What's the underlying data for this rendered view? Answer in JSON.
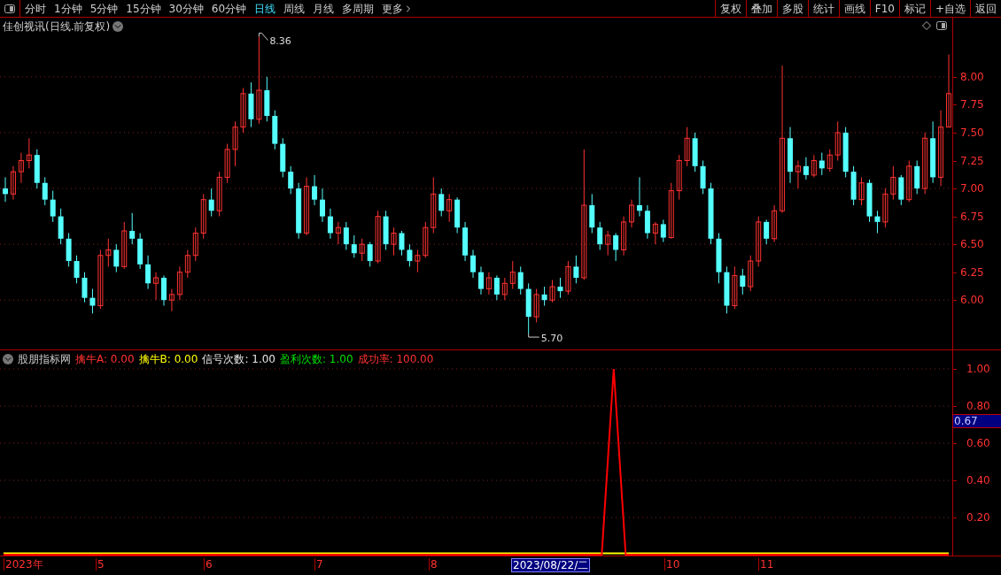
{
  "toolbar": {
    "periods": [
      {
        "label": "分时",
        "selected": false,
        "has_menu": false
      },
      {
        "label": "1分钟",
        "selected": false,
        "has_menu": false
      },
      {
        "label": "5分钟",
        "selected": false,
        "has_menu": false
      },
      {
        "label": "15分钟",
        "selected": false,
        "has_menu": false
      },
      {
        "label": "30分钟",
        "selected": false,
        "has_menu": false
      },
      {
        "label": "60分钟",
        "selected": false,
        "has_menu": false
      },
      {
        "label": "日线",
        "selected": true,
        "has_menu": false
      },
      {
        "label": "周线",
        "selected": false,
        "has_menu": false
      },
      {
        "label": "月线",
        "selected": false,
        "has_menu": false
      },
      {
        "label": "多周期",
        "selected": false,
        "has_menu": false
      },
      {
        "label": "更多",
        "selected": false,
        "has_menu": true
      }
    ],
    "actions": [
      "复权",
      "叠加",
      "多股",
      "统计",
      "画线",
      "F10",
      "标记",
      "+自选",
      "返回"
    ]
  },
  "price_pane": {
    "title": "佳创视讯(日线.前复权)",
    "high_label": "8.36",
    "low_label": "5.70",
    "chart_data": {
      "type": "candlestick",
      "grid": true,
      "ylim": [
        5.55,
        8.53
      ],
      "yticks": [
        {
          "value": 8.0,
          "label": "8.00"
        },
        {
          "value": 7.75,
          "label": "7.75"
        },
        {
          "value": 7.5,
          "label": "7.50"
        },
        {
          "value": 7.25,
          "label": "7.25"
        },
        {
          "value": 7.0,
          "label": "7.00"
        },
        {
          "value": 6.75,
          "label": "6.75"
        },
        {
          "value": 6.5,
          "label": "6.50"
        },
        {
          "value": 6.25,
          "label": "6.25"
        },
        {
          "value": 6.0,
          "label": "6.00"
        }
      ],
      "ohlc": [
        [
          7.0,
          7.1,
          6.88,
          6.95
        ],
        [
          6.95,
          7.2,
          6.9,
          7.15
        ],
        [
          7.15,
          7.32,
          7.05,
          7.25
        ],
        [
          7.25,
          7.45,
          7.18,
          7.3
        ],
        [
          7.3,
          7.35,
          7.0,
          7.05
        ],
        [
          7.05,
          7.1,
          6.85,
          6.9
        ],
        [
          6.9,
          6.98,
          6.7,
          6.75
        ],
        [
          6.75,
          6.82,
          6.5,
          6.55
        ],
        [
          6.55,
          6.6,
          6.3,
          6.35
        ],
        [
          6.35,
          6.4,
          6.15,
          6.2
        ],
        [
          6.2,
          6.25,
          5.98,
          6.02
        ],
        [
          6.02,
          6.1,
          5.88,
          5.95
        ],
        [
          5.95,
          6.45,
          5.92,
          6.4
        ],
        [
          6.4,
          6.55,
          6.3,
          6.45
        ],
        [
          6.45,
          6.5,
          6.25,
          6.3
        ],
        [
          6.3,
          6.7,
          6.28,
          6.62
        ],
        [
          6.62,
          6.78,
          6.5,
          6.55
        ],
        [
          6.55,
          6.6,
          6.28,
          6.32
        ],
        [
          6.32,
          6.4,
          6.1,
          6.15
        ],
        [
          6.15,
          6.25,
          6.0,
          6.2
        ],
        [
          6.2,
          6.22,
          5.95,
          6.0
        ],
        [
          6.0,
          6.1,
          5.9,
          6.05
        ],
        [
          6.05,
          6.3,
          6.0,
          6.25
        ],
        [
          6.25,
          6.45,
          6.2,
          6.4
        ],
        [
          6.4,
          6.65,
          6.35,
          6.6
        ],
        [
          6.6,
          6.95,
          6.55,
          6.9
        ],
        [
          6.9,
          7.0,
          6.75,
          6.8
        ],
        [
          6.8,
          7.15,
          6.75,
          7.1
        ],
        [
          7.1,
          7.4,
          7.05,
          7.35
        ],
        [
          7.35,
          7.6,
          7.2,
          7.55
        ],
        [
          7.55,
          7.9,
          7.5,
          7.85
        ],
        [
          7.85,
          7.95,
          7.55,
          7.62
        ],
        [
          7.62,
          8.36,
          7.58,
          7.88
        ],
        [
          7.88,
          8.0,
          7.6,
          7.65
        ],
        [
          7.65,
          7.7,
          7.35,
          7.4
        ],
        [
          7.4,
          7.45,
          7.1,
          7.15
        ],
        [
          7.15,
          7.2,
          6.95,
          7.0
        ],
        [
          7.0,
          7.05,
          6.55,
          6.6
        ],
        [
          6.6,
          7.1,
          6.58,
          7.02
        ],
        [
          7.02,
          7.12,
          6.85,
          6.9
        ],
        [
          6.9,
          7.0,
          6.7,
          6.75
        ],
        [
          6.75,
          6.82,
          6.55,
          6.6
        ],
        [
          6.6,
          6.7,
          6.5,
          6.65
        ],
        [
          6.65,
          6.7,
          6.45,
          6.5
        ],
        [
          6.5,
          6.58,
          6.38,
          6.42
        ],
        [
          6.42,
          6.55,
          6.35,
          6.5
        ],
        [
          6.5,
          6.52,
          6.3,
          6.35
        ],
        [
          6.35,
          6.8,
          6.33,
          6.75
        ],
        [
          6.75,
          6.8,
          6.45,
          6.5
        ],
        [
          6.5,
          6.65,
          6.4,
          6.6
        ],
        [
          6.6,
          6.62,
          6.4,
          6.45
        ],
        [
          6.45,
          6.5,
          6.3,
          6.35
        ],
        [
          6.35,
          6.45,
          6.25,
          6.4
        ],
        [
          6.4,
          6.7,
          6.38,
          6.65
        ],
        [
          6.65,
          7.1,
          6.6,
          6.95
        ],
        [
          6.95,
          7.0,
          6.75,
          6.8
        ],
        [
          6.8,
          6.95,
          6.7,
          6.9
        ],
        [
          6.9,
          6.92,
          6.6,
          6.65
        ],
        [
          6.65,
          6.7,
          6.35,
          6.4
        ],
        [
          6.4,
          6.45,
          6.2,
          6.25
        ],
        [
          6.25,
          6.3,
          6.05,
          6.1
        ],
        [
          6.1,
          6.25,
          6.05,
          6.2
        ],
        [
          6.2,
          6.22,
          6.0,
          6.05
        ],
        [
          6.05,
          6.2,
          6.0,
          6.15
        ],
        [
          6.15,
          6.35,
          6.1,
          6.25
        ],
        [
          6.25,
          6.3,
          6.05,
          6.1
        ],
        [
          6.1,
          6.15,
          5.7,
          5.85
        ],
        [
          5.85,
          6.1,
          5.8,
          6.05
        ],
        [
          6.05,
          6.12,
          5.95,
          6.0
        ],
        [
          6.0,
          6.18,
          5.98,
          6.12
        ],
        [
          6.12,
          6.2,
          6.02,
          6.08
        ],
        [
          6.08,
          6.35,
          6.05,
          6.3
        ],
        [
          6.3,
          6.4,
          6.15,
          6.2
        ],
        [
          6.2,
          7.35,
          6.18,
          6.85
        ],
        [
          6.85,
          6.95,
          6.6,
          6.65
        ],
        [
          6.65,
          6.7,
          6.45,
          6.5
        ],
        [
          6.5,
          6.62,
          6.4,
          6.58
        ],
        [
          6.58,
          6.6,
          6.35,
          6.45
        ],
        [
          6.45,
          6.75,
          6.4,
          6.7
        ],
        [
          6.7,
          6.9,
          6.65,
          6.85
        ],
        [
          6.85,
          7.1,
          6.75,
          6.8
        ],
        [
          6.8,
          6.85,
          6.55,
          6.6
        ],
        [
          6.6,
          6.7,
          6.5,
          6.68
        ],
        [
          6.68,
          6.72,
          6.52,
          6.56
        ],
        [
          6.56,
          7.05,
          6.55,
          6.98
        ],
        [
          6.98,
          7.3,
          6.9,
          7.25
        ],
        [
          7.25,
          7.55,
          7.2,
          7.45
        ],
        [
          7.45,
          7.5,
          7.15,
          7.2
        ],
        [
          7.2,
          7.25,
          6.95,
          7.0
        ],
        [
          7.0,
          7.05,
          6.5,
          6.55
        ],
        [
          6.55,
          6.6,
          6.15,
          6.25
        ],
        [
          6.25,
          6.3,
          5.88,
          5.95
        ],
        [
          5.95,
          6.3,
          5.92,
          6.22
        ],
        [
          6.22,
          6.28,
          6.05,
          6.12
        ],
        [
          6.12,
          6.4,
          6.08,
          6.35
        ],
        [
          6.35,
          6.75,
          6.3,
          6.7
        ],
        [
          6.7,
          6.72,
          6.5,
          6.55
        ],
        [
          6.55,
          6.85,
          6.52,
          6.8
        ],
        [
          6.8,
          8.1,
          6.78,
          7.45
        ],
        [
          7.45,
          7.55,
          7.05,
          7.15
        ],
        [
          7.15,
          7.25,
          7.0,
          7.2
        ],
        [
          7.2,
          7.28,
          7.08,
          7.12
        ],
        [
          7.12,
          7.3,
          7.1,
          7.25
        ],
        [
          7.25,
          7.32,
          7.12,
          7.18
        ],
        [
          7.18,
          7.35,
          7.15,
          7.3
        ],
        [
          7.3,
          7.6,
          7.25,
          7.5
        ],
        [
          7.5,
          7.55,
          7.1,
          7.15
        ],
        [
          7.15,
          7.2,
          6.85,
          6.9
        ],
        [
          6.9,
          7.1,
          6.85,
          7.05
        ],
        [
          7.05,
          7.08,
          6.7,
          6.75
        ],
        [
          6.75,
          6.8,
          6.6,
          6.7
        ],
        [
          6.7,
          7.0,
          6.65,
          6.95
        ],
        [
          6.95,
          7.2,
          6.9,
          7.1
        ],
        [
          7.1,
          7.12,
          6.85,
          6.9
        ],
        [
          6.9,
          7.25,
          6.88,
          7.2
        ],
        [
          7.2,
          7.25,
          6.95,
          7.0
        ],
        [
          7.0,
          7.5,
          6.95,
          7.45
        ],
        [
          7.45,
          7.6,
          7.05,
          7.1
        ],
        [
          7.1,
          7.7,
          7.02,
          7.55
        ],
        [
          7.55,
          8.2,
          7.55,
          7.85
        ]
      ]
    }
  },
  "indicator_pane": {
    "title": "股朋指标网",
    "legend": [
      {
        "text": "擒牛A: 0.00",
        "color": "#ff3232"
      },
      {
        "text": "擒牛B: 0.00",
        "color": "#ffff00"
      },
      {
        "text": "信号次数: 1.00",
        "color": "#e6e6e6"
      },
      {
        "text": "盈利次数: 1.00",
        "color": "#00e000"
      },
      {
        "text": "成功率: 100.00",
        "color": "#ff3232"
      }
    ],
    "cursor_value": "0.67",
    "chart_data": {
      "type": "line",
      "grid": true,
      "ylim": [
        0,
        1.1
      ],
      "yticks": [
        {
          "value": 1.0,
          "label": "1.00"
        },
        {
          "value": 0.8,
          "label": "0.80"
        },
        {
          "value": 0.6,
          "label": "0.60"
        },
        {
          "value": 0.4,
          "label": "0.40"
        },
        {
          "value": 0.2,
          "label": "0.20"
        }
      ],
      "series": [
        {
          "color": "#ff0000",
          "values": [
            0,
            0,
            0,
            0,
            0,
            0,
            0,
            0,
            0,
            0,
            0,
            0,
            0,
            0,
            0,
            0,
            0,
            0,
            0,
            0,
            0,
            0,
            0,
            0,
            0,
            0,
            0,
            0,
            0,
            0,
            0,
            0,
            0,
            0,
            0,
            0,
            0,
            0,
            0,
            0,
            0,
            0,
            0,
            0,
            0,
            0,
            0,
            0,
            0,
            0,
            0,
            1,
            0,
            0,
            0,
            0,
            0,
            0,
            0,
            0,
            0,
            0,
            0,
            0,
            0,
            0,
            0,
            0,
            0,
            0,
            0,
            0,
            0,
            0,
            0,
            0,
            0,
            0,
            0,
            0
          ]
        },
        {
          "color": "#ffff00",
          "values": [
            0,
            0,
            0,
            0,
            0,
            0,
            0,
            0,
            0,
            0,
            0,
            0,
            0,
            0,
            0,
            0,
            0,
            0,
            0,
            0,
            0,
            0,
            0,
            0,
            0,
            0,
            0,
            0,
            0,
            0,
            0,
            0,
            0,
            0,
            0,
            0,
            0,
            0,
            0,
            0,
            0,
            0,
            0,
            0,
            0,
            0,
            0,
            0,
            0,
            0,
            0,
            0,
            0,
            0,
            0,
            0,
            0,
            0,
            0,
            0,
            0,
            0,
            0,
            0,
            0,
            0,
            0,
            0,
            0,
            0,
            0,
            0,
            0,
            0,
            0,
            0,
            0,
            0,
            0,
            0
          ]
        }
      ]
    }
  },
  "date_axis": [
    {
      "label": "2023年",
      "selected": false
    },
    {
      "label": "5",
      "selected": false
    },
    {
      "label": "6",
      "selected": false
    },
    {
      "label": "7",
      "selected": false
    },
    {
      "label": "8",
      "selected": false
    },
    {
      "label": "2023/08/22/二",
      "selected": true
    },
    {
      "label": "10",
      "selected": false
    },
    {
      "label": "11",
      "selected": false
    }
  ]
}
